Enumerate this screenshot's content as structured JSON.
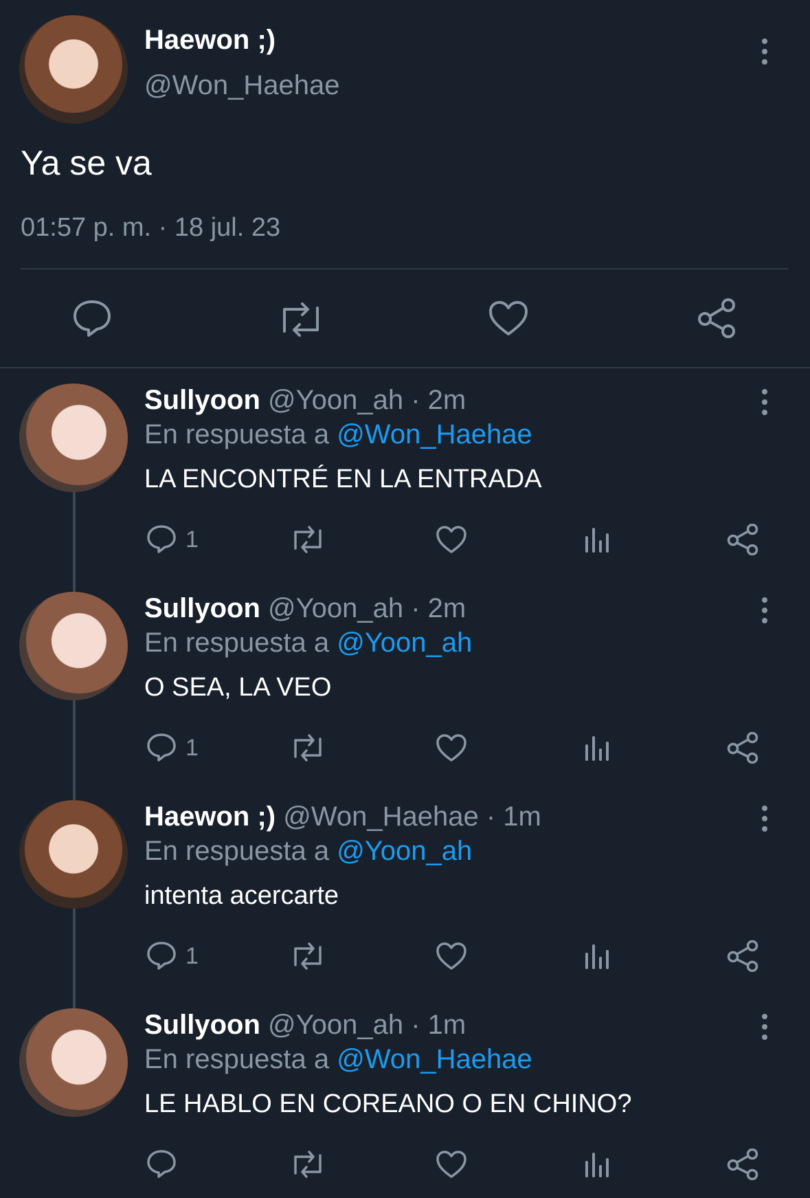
{
  "main_tweet": {
    "display_name": "Haewon ;)",
    "handle": "@Won_Haehae",
    "text": "Ya se va",
    "timestamp": "01:57 p. m. · 18 jul. 23"
  },
  "replies": [
    {
      "display_name": "Sullyoon",
      "meta": "@Yoon_ah · 2m",
      "reply_prefix": "En respuesta a",
      "reply_to": "@Won_Haehae",
      "text": "LA ENCONTRÉ EN LA ENTRADA",
      "reply_count": "1"
    },
    {
      "display_name": "Sullyoon",
      "meta": "@Yoon_ah · 2m",
      "reply_prefix": "En respuesta a",
      "reply_to": "@Yoon_ah",
      "text": "O SEA, LA VEO",
      "reply_count": "1"
    },
    {
      "display_name": "Haewon ;)",
      "meta": "@Won_Haehae · 1m",
      "reply_prefix": "En respuesta a",
      "reply_to": "@Yoon_ah",
      "text": "intenta acercarte",
      "reply_count": "1"
    },
    {
      "display_name": "Sullyoon",
      "meta": "@Yoon_ah · 1m",
      "reply_prefix": "En respuesta a",
      "reply_to": "@Won_Haehae",
      "text": "LE HABLO EN COREANO O EN CHINO?",
      "reply_count": ""
    }
  ],
  "colors": {
    "background": "#17202b",
    "link": "#1d9bf0",
    "muted": "#8a96a3"
  }
}
